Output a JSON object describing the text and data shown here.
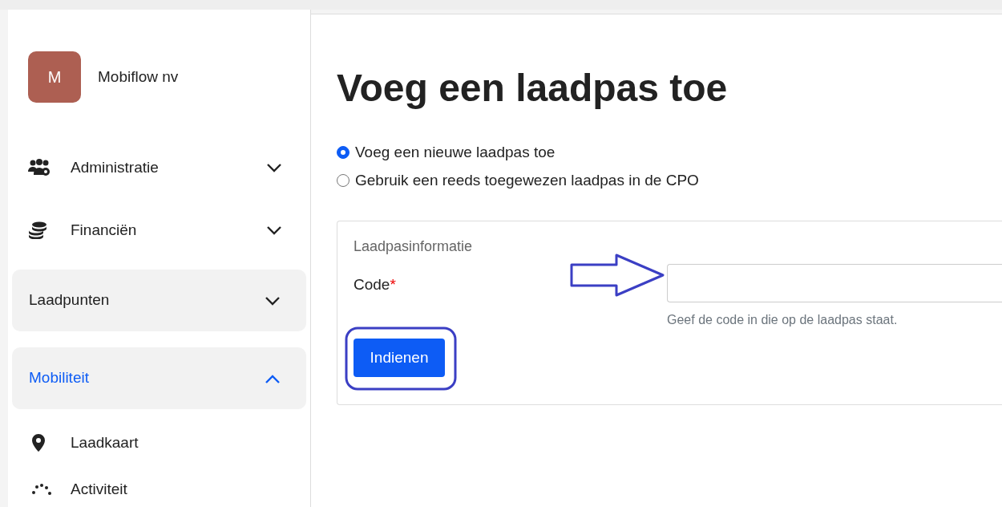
{
  "sidebar": {
    "account": {
      "initial": "M",
      "name": "Mobiflow nv"
    },
    "items": [
      {
        "kind": "link",
        "label": "Administratie",
        "expanded": false
      },
      {
        "kind": "link",
        "label": "Financiën",
        "expanded": false
      },
      {
        "kind": "group",
        "label": "Laadpunten",
        "expanded": false
      },
      {
        "kind": "group",
        "label": "Mobiliteit",
        "expanded": true
      },
      {
        "kind": "leaf",
        "label": "Laadkaart"
      },
      {
        "kind": "leaf",
        "label": "Activiteit"
      }
    ]
  },
  "page": {
    "title": "Voeg een laadpas toe",
    "options": [
      {
        "label": "Voeg een nieuwe laadpas toe",
        "selected": true
      },
      {
        "label": "Gebruik een reeds toegewezen laadpas in de CPO",
        "selected": false
      }
    ],
    "card": {
      "legend": "Laadpasinformatie",
      "field": {
        "label": "Code",
        "required_mark": "*",
        "help": "Geef de code in die op de laadpas staat."
      },
      "submit": "Indienen"
    }
  }
}
